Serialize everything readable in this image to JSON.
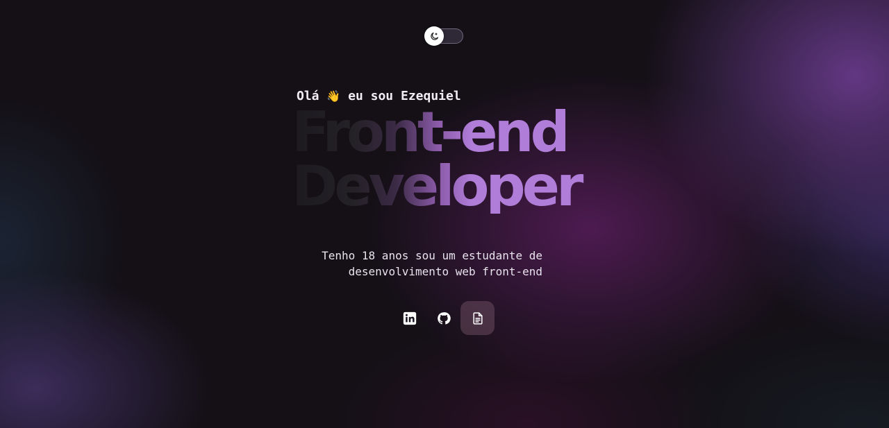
{
  "theme_toggle": {
    "icon": "moon-icon",
    "state": "dark"
  },
  "hero": {
    "greeting": "Olá",
    "wave_emoji": "👋",
    "greeting_rest": "eu sou Ezequiel",
    "title_line1": "Front-end",
    "title_line2": "Developer",
    "bio_line1": "Tenho 18 anos sou um estudante de",
    "bio_line2": "desenvolvimento web front-end"
  },
  "social_links": [
    {
      "icon": "linkedin-icon",
      "label": "LinkedIn"
    },
    {
      "icon": "github-icon",
      "label": "GitHub"
    },
    {
      "icon": "document-icon",
      "label": "Currículo"
    }
  ],
  "colors": {
    "accent": "#b07dd8",
    "text": "#f1edf4"
  }
}
